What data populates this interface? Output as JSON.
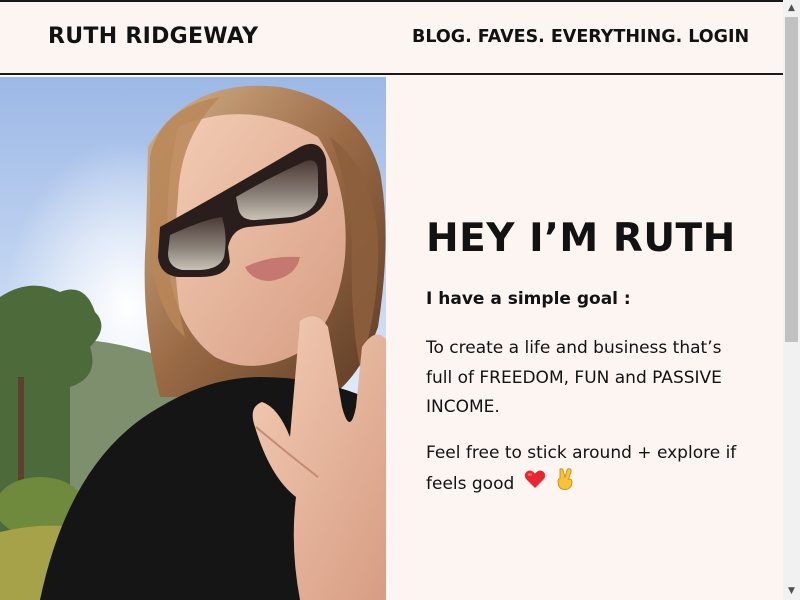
{
  "header": {
    "brand": "RUTH RIDGEWAY",
    "nav": [
      "BLOG.",
      "FAVES.",
      "EVERYTHING.",
      "LOGIN"
    ]
  },
  "hero": {
    "title": "HEY I’M RUTH",
    "goal": "I have a simple goal :",
    "paragraph1": "To create a life and business that’s full of FREEDOM, FUN and PASSIVE INCOME.",
    "paragraph2": "Feel free to stick around + explore if feels good"
  },
  "icons": {
    "heart": "red-heart-emoji",
    "peace": "victory-hand-emoji"
  },
  "colors": {
    "background": "#fdf5f2",
    "text": "#121212",
    "heart": "#e8262f"
  },
  "scrollbar": {
    "up": "▲",
    "down": "▼"
  }
}
